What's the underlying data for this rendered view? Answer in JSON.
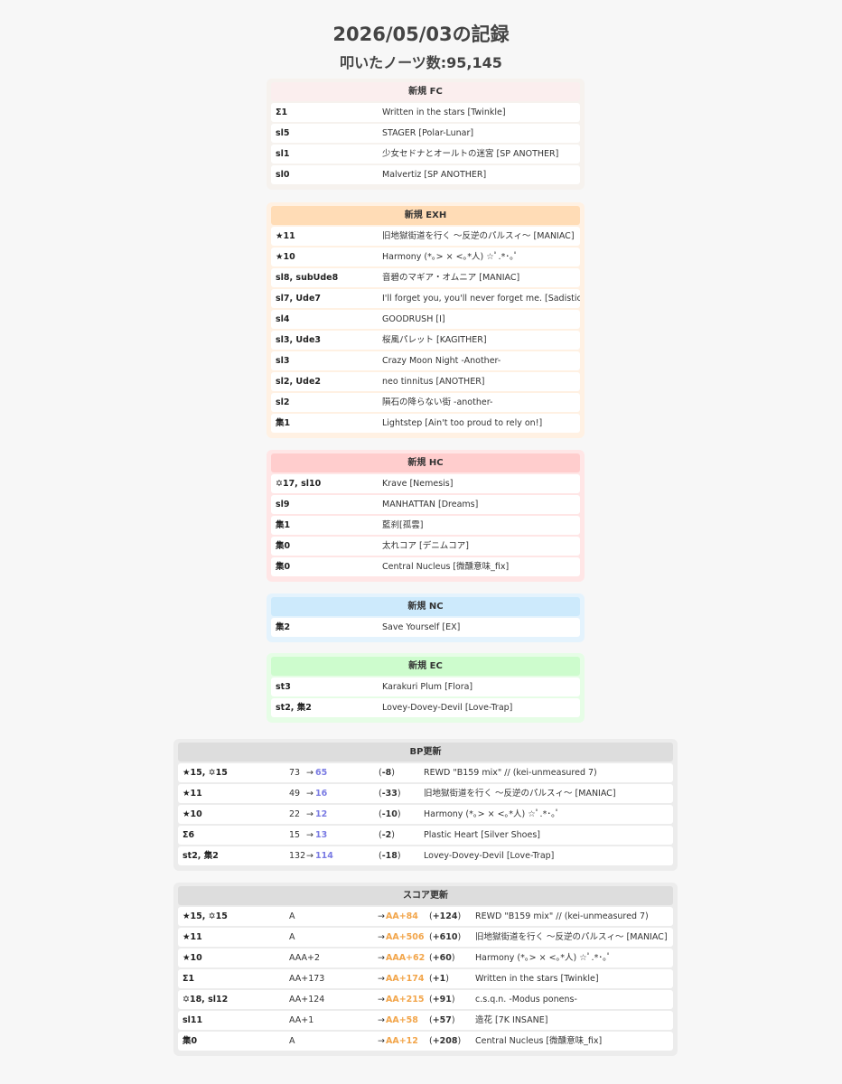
{
  "title": "2026/05/03の記録",
  "subtitle": "叩いたノーツ数:95,145",
  "fc": {
    "title": "新規 FC",
    "rows": [
      {
        "lvl": "Σ1",
        "song": "Written in the stars [Twinkle]"
      },
      {
        "lvl": "sl5",
        "song": "STAGER [Polar-Lunar]"
      },
      {
        "lvl": "sl1",
        "song": "少女セドナとオールトの迷宮 [SP ANOTHER]"
      },
      {
        "lvl": "sl0",
        "song": "Malvertiz [SP ANOTHER]"
      }
    ]
  },
  "exh": {
    "title": "新規 EXH",
    "rows": [
      {
        "lvl": "★11",
        "song": "旧地獄街道を行く 〜反逆のパルスィ〜 [MANIAC]"
      },
      {
        "lvl": "★10",
        "song": "Harmony (*｡> × <｡*人) ☆ﾟ.*･｡ﾟ"
      },
      {
        "lvl": "sl8, subUde8",
        "song": "音碧のマギア・オムニア [MANIAC]"
      },
      {
        "lvl": "sl7, Ude7",
        "song": "I'll forget you, you'll never forget me. [Sadistic]"
      },
      {
        "lvl": "sl4",
        "song": "GOODRUSH [I]"
      },
      {
        "lvl": "sl3, Ude3",
        "song": "桜風パレット [KAGITHER]"
      },
      {
        "lvl": "sl3",
        "song": "Crazy Moon Night -Another-"
      },
      {
        "lvl": "sl2, Ude2",
        "song": "neo tinnitus [ANOTHER]"
      },
      {
        "lvl": "sl2",
        "song": "隕石の降らない街 -another-"
      },
      {
        "lvl": "集1",
        "song": "Lightstep [Ain't too proud to rely on!]"
      }
    ]
  },
  "hc": {
    "title": "新規 HC",
    "rows": [
      {
        "lvl": "✡17, sl10",
        "song": "Krave [Nemesis]"
      },
      {
        "lvl": "sl9",
        "song": "MANHATTAN [Dreams]"
      },
      {
        "lvl": "集1",
        "song": "藍刹[孤雲]"
      },
      {
        "lvl": "集0",
        "song": "太れコア [デニムコア]"
      },
      {
        "lvl": "集0",
        "song": "Central Nucleus [微醺意味_fix]"
      }
    ]
  },
  "nc": {
    "title": "新規 NC",
    "rows": [
      {
        "lvl": "集2",
        "song": "Save Yourself [EX]"
      }
    ]
  },
  "ec": {
    "title": "新規 EC",
    "rows": [
      {
        "lvl": "st3",
        "song": "Karakuri Plum [Flora]"
      },
      {
        "lvl": "st2, 集2",
        "song": "Lovey-Dovey-Devil [Love-Trap]"
      }
    ]
  },
  "bp": {
    "title": "BP更新",
    "rows": [
      {
        "lvl": "★15, ✡15",
        "before": "73",
        "arrow": "→",
        "after": "65",
        "diff": "-8",
        "song": "REWD \"B159 mix\" // (kei-unmeasured 7)"
      },
      {
        "lvl": "★11",
        "before": "49",
        "arrow": "→",
        "after": "16",
        "diff": "-33",
        "song": "旧地獄街道を行く 〜反逆のパルスィ〜 [MANIAC]"
      },
      {
        "lvl": "★10",
        "before": "22",
        "arrow": "→",
        "after": "12",
        "diff": "-10",
        "song": "Harmony (*｡> × <｡*人) ☆ﾟ.*･｡ﾟ"
      },
      {
        "lvl": "Σ6",
        "before": "15",
        "arrow": "→",
        "after": "13",
        "diff": "-2",
        "song": "Plastic Heart [Silver Shoes]"
      },
      {
        "lvl": "st2, 集2",
        "before": "132",
        "arrow": "→",
        "after": "114",
        "diff": "-18",
        "song": "Lovey-Dovey-Devil [Love-Trap]"
      }
    ]
  },
  "score": {
    "title": "スコア更新",
    "rows": [
      {
        "lvl": "★15, ✡15",
        "before": "A",
        "arrow": "→",
        "after": "AA+84",
        "diff": "+124",
        "song": "REWD \"B159 mix\" // (kei-unmeasured 7)"
      },
      {
        "lvl": "★11",
        "before": "A",
        "arrow": "→",
        "after": "AA+506",
        "diff": "+610",
        "song": "旧地獄街道を行く 〜反逆のパルスィ〜 [MANIAC]"
      },
      {
        "lvl": "★10",
        "before": "AAA+2",
        "arrow": "→",
        "after": "AAA+62",
        "diff": "+60",
        "song": "Harmony (*｡> × <｡*人) ☆ﾟ.*･｡ﾟ"
      },
      {
        "lvl": "Σ1",
        "before": "AA+173",
        "arrow": "→",
        "after": "AA+174",
        "diff": "+1",
        "song": "Written in the stars [Twinkle]"
      },
      {
        "lvl": "✡18, sl12",
        "before": "AA+124",
        "arrow": "→",
        "after": "AA+215",
        "diff": "+91",
        "song": "c.s.q.n. -Modus ponens-"
      },
      {
        "lvl": "sl11",
        "before": "AA+1",
        "arrow": "→",
        "after": "AA+58",
        "diff": "+57",
        "song": "造花 [7K INSANE]"
      },
      {
        "lvl": "集0",
        "before": "A",
        "arrow": "→",
        "after": "AA+12",
        "diff": "+208",
        "song": "Central Nucleus [微醺意味_fix]"
      }
    ]
  },
  "colors": {
    "fc_head": "#fbeeee",
    "fc_bg": "#f6f2ee",
    "exh_head": "#ffdcb6",
    "exh_bg": "#fff1e3",
    "hc_head": "#ffcdcd",
    "hc_bg": "#ffe6e6",
    "nc_head": "#cdeafc",
    "nc_bg": "#e4f3fd",
    "ec_head": "#cdfccd",
    "ec_bg": "#e6fde6",
    "update_head": "#dddddd",
    "update_bg": "#ececec",
    "bp_after": "#7a7be3",
    "score_after": "#f2a54a"
  }
}
